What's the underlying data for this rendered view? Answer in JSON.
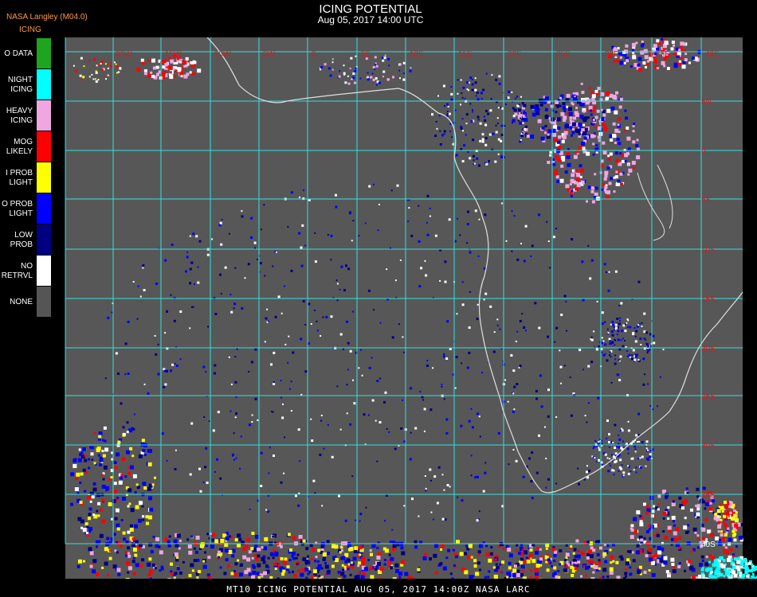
{
  "header": {
    "org": "NASA Langley (M04.0)",
    "product": "ICING",
    "title": "ICING POTENTIAL",
    "subtitle": "Aug 05, 2017 14:00 UTC"
  },
  "legend": [
    {
      "label": "O DATA",
      "color": "#1ea51e"
    },
    {
      "label": "NIGHT\nICING",
      "color": "#00ffff"
    },
    {
      "label": "HEAVY\nICING",
      "color": "#f0a6e0"
    },
    {
      "label": "MOG\nLIKELY",
      "color": "#ff0000"
    },
    {
      "label": "I PROB\nLIGHT",
      "color": "#ffff00"
    },
    {
      "label": "O PROB\nLIGHT",
      "color": "#0000ff"
    },
    {
      "label": "LOW\nPROB",
      "color": "#000080"
    },
    {
      "label": "NO\nRETRVL",
      "color": "#ffffff"
    },
    {
      "label": "NONE",
      "color": "#555555"
    }
  ],
  "map": {
    "background_color": "#575757",
    "grid_color": "#30e0e0",
    "coast_color": "#e0e0e0",
    "label_color": "#cc2020",
    "lon_labels": [
      "20W",
      "15W",
      "10W",
      "5W",
      "0",
      "5E",
      "10E",
      "15E",
      "20E",
      "25E",
      "30E",
      "35E",
      "40E"
    ],
    "lat_labels": [
      "5N",
      "0",
      "5S",
      "10S",
      "15S",
      "20S",
      "25S",
      "30S",
      "35S",
      "40S"
    ]
  },
  "footer": "MT10  ICING POTENTIAL   AUG 05, 2017 14:00Z   NASA LARC"
}
